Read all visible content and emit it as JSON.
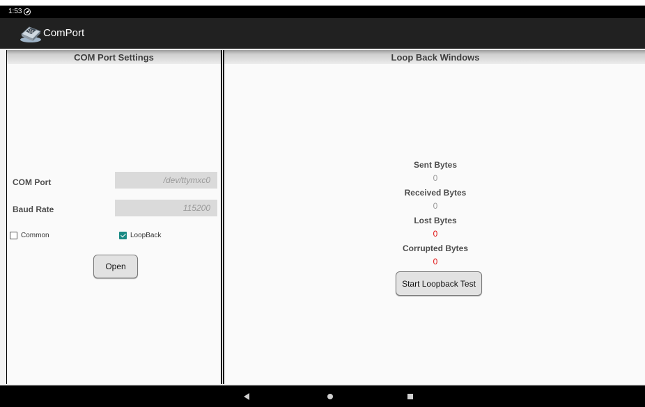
{
  "status_bar": {
    "time": "1:53"
  },
  "app_bar": {
    "title": "ComPort"
  },
  "settings_panel": {
    "header": "COM Port Settings",
    "com_port_label": "COM Port",
    "com_port_value": "/dev/ttymxc0",
    "baud_rate_label": "Baud Rate",
    "baud_rate_value": "115200",
    "common_label": "Common",
    "common_checked": false,
    "loopback_label": "LoopBack",
    "loopback_checked": true,
    "open_button": "Open"
  },
  "loopback_panel": {
    "header": "Loop Back Windows",
    "sent_label": "Sent Bytes",
    "sent_value": "0",
    "received_label": "Received Bytes",
    "received_value": "0",
    "lost_label": "Lost Bytes",
    "lost_value": "0",
    "corrupted_label": "Corrupted Bytes",
    "corrupted_value": "0",
    "start_button": "Start Loopback Test"
  },
  "colors": {
    "app_bar": "#212121",
    "checkbox_accent": "#1a8a84",
    "error_value": "#e01010"
  },
  "icons": [
    "sync-icon",
    "serial-port-logo-icon",
    "back-icon",
    "home-icon",
    "recents-icon"
  ]
}
